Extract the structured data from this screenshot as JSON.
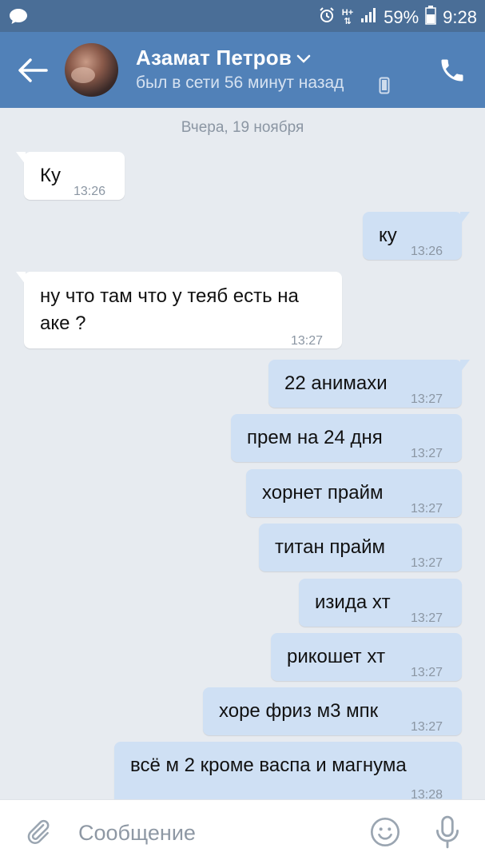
{
  "status_bar": {
    "battery_percent": "59%",
    "time": "9:28",
    "network": "H+",
    "icons": [
      "message-icon",
      "alarm-icon",
      "network-icon",
      "signal-icon",
      "battery-icon"
    ]
  },
  "header": {
    "name": "Азамат Петров",
    "status": "был в сети 56 минут назад",
    "icons": [
      "back-arrow-icon",
      "chevron-down-icon",
      "mobile-device-icon",
      "phone-icon"
    ]
  },
  "chat": {
    "date": "Вчера, 19 ноября",
    "messages": [
      {
        "direction": "in",
        "text": "Ку",
        "time": "13:26"
      },
      {
        "direction": "out",
        "text": "ку",
        "time": "13:26"
      },
      {
        "direction": "in",
        "text": "ну что там что у теяб есть на аке ?",
        "time": "13:27"
      },
      {
        "direction": "out",
        "text": "22 анимахи",
        "time": "13:27"
      },
      {
        "direction": "out",
        "text": "прем на 24 дня",
        "time": "13:27"
      },
      {
        "direction": "out",
        "text": "хорнет прайм",
        "time": "13:27"
      },
      {
        "direction": "out",
        "text": "титан прайм",
        "time": "13:27"
      },
      {
        "direction": "out",
        "text": "изида хт",
        "time": "13:27"
      },
      {
        "direction": "out",
        "text": "рикошет хт",
        "time": "13:27"
      },
      {
        "direction": "out",
        "text": "хоре фриз м3 мпк",
        "time": "13:27"
      },
      {
        "direction": "out",
        "text": "всё м 2 кроме васпа и магнума",
        "time": "13:28"
      }
    ]
  },
  "composer": {
    "placeholder": "Сообщение",
    "value": "",
    "icons": [
      "paperclip-icon",
      "emoji-icon",
      "microphone-icon"
    ]
  },
  "colors": {
    "header": "#5181b8",
    "status_bar": "#4a6e97",
    "chat_background": "#e7ebf0",
    "incoming_bubble": "#ffffff",
    "outgoing_bubble": "#cfe0f4",
    "timestamp": "#8b96a3"
  }
}
